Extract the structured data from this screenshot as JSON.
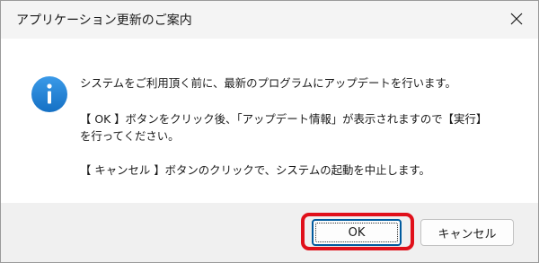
{
  "window": {
    "title": "アプリケーション更新のご案内"
  },
  "icon": {
    "name": "info-icon",
    "glyph": "i",
    "color": "#1a7fd6"
  },
  "message": {
    "line1": "システムをご利用頂く前に、最新のプログラムにアップデートを行います。",
    "line2": "【 OK 】ボタンをクリック後、「アップデート情報」が表示されますので【実行】",
    "line3": "を行ってください。",
    "line4": "【 キャンセル 】ボタンのクリックで、システムの起動を中止します。"
  },
  "buttons": {
    "ok_label": "OK",
    "cancel_label": "キャンセル"
  },
  "colors": {
    "highlight": "#e0101a",
    "accent": "#005a9e"
  }
}
